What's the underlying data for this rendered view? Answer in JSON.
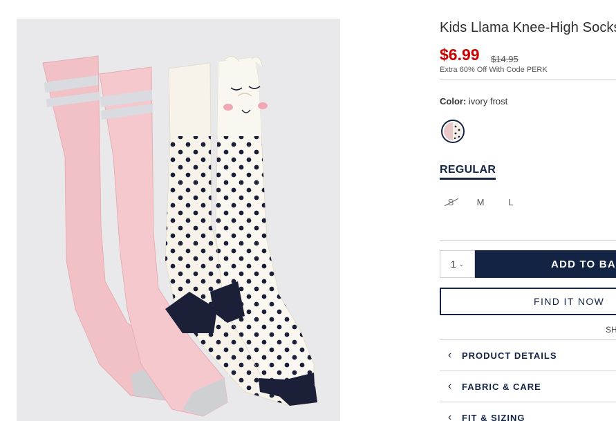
{
  "product": {
    "title": "Kids Llama Knee-High Socks",
    "price_now": "$6.99",
    "price_was": "$14.95",
    "promo": "Extra 60% Off With Code PERK",
    "color_label": "Color:",
    "color_value": "ivory frost"
  },
  "fit": {
    "tab_label": "REGULAR"
  },
  "sizes": [
    {
      "label": "S",
      "available": false
    },
    {
      "label": "M",
      "available": true
    },
    {
      "label": "L",
      "available": true
    }
  ],
  "cart": {
    "quantity": "1",
    "add_label": "ADD TO BAG",
    "find_label": "FIND IT NOW",
    "ship_text": "SH"
  },
  "accordions": [
    {
      "label": "PRODUCT DETAILS"
    },
    {
      "label": "FABRIC & CARE"
    },
    {
      "label": "FIT & SIZING"
    }
  ],
  "colors": {
    "sale": "#cc0000",
    "navy": "#122344",
    "sock_pink": "#f0c2c6",
    "sock_ivory": "#f7f3ea",
    "dots": "#1b2038"
  }
}
